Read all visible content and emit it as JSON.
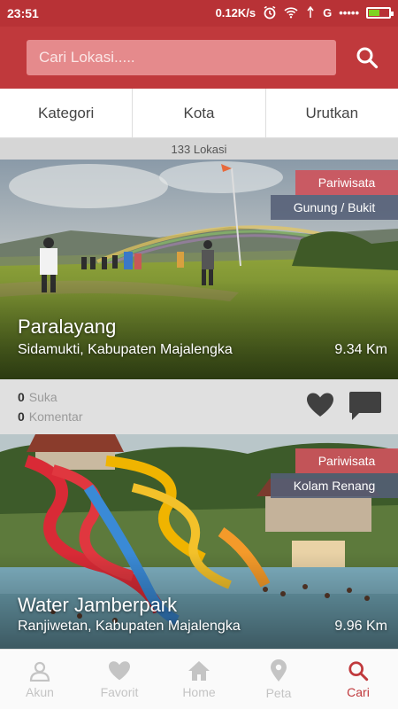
{
  "statusbar": {
    "time": "23:51",
    "speed": "0.12K/s",
    "carrier": "G",
    "signal": "•••••",
    "battery_level": 0.55
  },
  "search": {
    "placeholder": "Cari Lokasi....."
  },
  "filters": [
    {
      "label": "Kategori"
    },
    {
      "label": "Kota"
    },
    {
      "label": "Urutkan"
    }
  ],
  "count_label": "133 Lokasi",
  "cards": [
    {
      "name": "Paralayang",
      "location": "Sidamukti, Kabupaten Majalengka",
      "distance": "9.34 Km",
      "category": "Pariwisata",
      "subcategory": "Gunung / Bukit",
      "likes": "0",
      "likes_label": "Suka",
      "comments": "0",
      "comments_label": "Komentar"
    },
    {
      "name": "Water Jamberpark",
      "location": "Ranjiwetan, Kabupaten Majalengka",
      "distance": "9.96 Km",
      "category": "Pariwisata",
      "subcategory": "Kolam Renang"
    }
  ],
  "nav": [
    {
      "label": "Akun",
      "icon": "person-icon"
    },
    {
      "label": "Favorit",
      "icon": "heart-icon"
    },
    {
      "label": "Home",
      "icon": "home-icon"
    },
    {
      "label": "Peta",
      "icon": "map-pin-icon"
    },
    {
      "label": "Cari",
      "icon": "search-icon",
      "active": true
    }
  ],
  "colors": {
    "primary": "#c0393c",
    "statusbar": "#b83236",
    "category_tag": "#cd545c",
    "subcategory_tag": "#545e76"
  }
}
